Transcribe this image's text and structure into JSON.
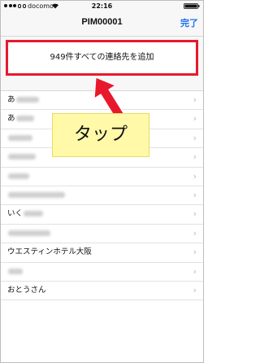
{
  "status_bar": {
    "carrier": "docomo",
    "time": "22:16"
  },
  "nav": {
    "title": "PIM00001",
    "done_label": "完了"
  },
  "add_all_label": "949件すべての連絡先を追加",
  "contacts": [
    {
      "name": "あ",
      "blurred": true
    },
    {
      "name": "あ",
      "blurred": true
    },
    {
      "name": "",
      "blurred": true
    },
    {
      "name": "",
      "blurred": true
    },
    {
      "name": "",
      "blurred": true
    },
    {
      "name": "",
      "blurred": true
    },
    {
      "name": "いく",
      "blurred": true
    },
    {
      "name": "",
      "blurred": true
    },
    {
      "name": "ウエスティンホテル大阪",
      "blurred": false
    },
    {
      "name": "",
      "blurred": true
    },
    {
      "name": "おとうさん",
      "blurred": false
    }
  ],
  "annotation": {
    "label": "タップ",
    "arrow_color": "#e8192c"
  },
  "colors": {
    "accent": "#1a6ff2",
    "highlight_border": "#e8192c",
    "callout_bg": "#fff9a8"
  }
}
